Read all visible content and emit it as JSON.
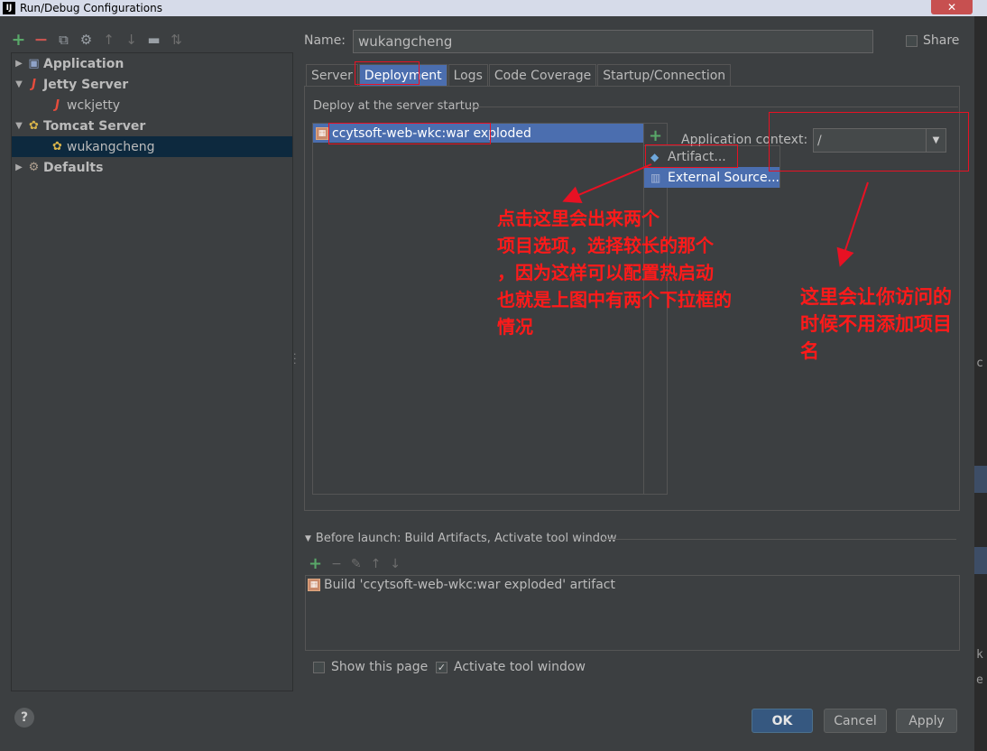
{
  "window": {
    "title": "Run/Debug Configurations",
    "app_logo": "IJ",
    "close_glyph": "✕"
  },
  "tree": {
    "items": [
      {
        "label": "Application",
        "icon": "application-icon",
        "bold": true
      },
      {
        "label": "Jetty Server",
        "icon": "jetty-icon",
        "bold": true
      },
      {
        "label": "wckjetty",
        "icon": "jetty-icon",
        "bold": false
      },
      {
        "label": "Tomcat Server",
        "icon": "tomcat-icon",
        "bold": true
      },
      {
        "label": "wukangcheng",
        "icon": "tomcat-icon",
        "bold": false,
        "selected": true
      },
      {
        "label": "Defaults",
        "icon": "wrench-icon",
        "bold": true
      }
    ]
  },
  "name": {
    "label": "Name:",
    "value": "wukangcheng"
  },
  "share": {
    "label": "Share",
    "checked": false
  },
  "tabs": [
    {
      "label": "Server"
    },
    {
      "label": "Deployment",
      "active": true
    },
    {
      "label": "Logs"
    },
    {
      "label": "Code Coverage"
    },
    {
      "label": "Startup/Connection"
    }
  ],
  "deployment": {
    "section_label": "Deploy at the server startup",
    "artifact": "ccytsoft-web-wkc:war exploded",
    "popup": [
      "Artifact...",
      "External Source..."
    ],
    "context_label": "Application context:",
    "context_value": "/"
  },
  "before_launch": {
    "header": "Before launch: Build Artifacts, Activate tool window",
    "items": [
      "Build 'ccytsoft-web-wkc:war exploded' artifact"
    ]
  },
  "options": {
    "show_page": {
      "label": "Show this page",
      "checked": false
    },
    "activate_tool": {
      "label": "Activate tool window",
      "checked": true
    }
  },
  "buttons": {
    "ok": "OK",
    "cancel": "Cancel",
    "apply": "Apply",
    "help": "?"
  },
  "annotations": {
    "left": [
      "点击这里会出来两个",
      "项目选项，选择较长的那个",
      "，因为这样可以配置热启动",
      "也就是上图中有两个下拉框的",
      "情况"
    ],
    "right": [
      "这里会让你访问的",
      "时候不用添加项目",
      "名"
    ]
  },
  "colors": {
    "annotation": "#e81123",
    "selection": "#4b6eaf",
    "tree_selection": "#0d293e",
    "add": "#59a869",
    "remove": "#c75450"
  }
}
